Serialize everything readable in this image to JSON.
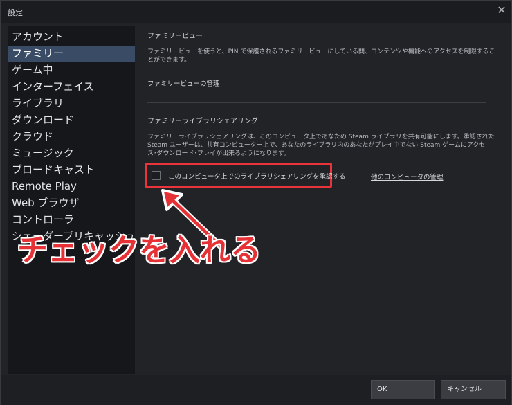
{
  "window": {
    "title": "設定",
    "minimize_glyph": "—",
    "close_glyph": "✕"
  },
  "sidebar": {
    "items": [
      {
        "label": "アカウント"
      },
      {
        "label": "ファミリー"
      },
      {
        "label": "ゲーム中"
      },
      {
        "label": "インターフェイス"
      },
      {
        "label": "ライブラリ"
      },
      {
        "label": "ダウンロード"
      },
      {
        "label": "クラウド"
      },
      {
        "label": "ミュージック"
      },
      {
        "label": "ブロードキャスト"
      },
      {
        "label": "Remote Play"
      },
      {
        "label": "Web ブラウザ"
      },
      {
        "label": "コントローラ"
      },
      {
        "label": "シェーダープリキャッシュ"
      }
    ],
    "active_index": 1
  },
  "family_view": {
    "title": "ファミリービュー",
    "desc_line1": "ファミリービューを使うと、PIN で保護されるファミリービューにしている間、コンテンツや機能へのアクセスを制限するこ",
    "desc_line2": "とができます。",
    "manage_link": "ファミリービューの管理"
  },
  "library_sharing": {
    "title": "ファミリーライブラリシェアリング",
    "desc_line1": "ファミリーライブラリシェアリングは、このコンピュータ上であなたの Steam ライブラリを共有可能にします。承認された",
    "desc_line2": "Steam ユーザーは、共有コンピューター上で、あなたのライブラリ内のあなたがプレイ中でない Steam ゲームにアクセ",
    "desc_line3": "ス･ダウンロード･プレイが出来るようになります。",
    "checkbox_label": "このコンピュータ上でのライブラリシェアリングを承認する",
    "checkbox_checked": false,
    "other_computers_link": "他のコンピュータの管理"
  },
  "annotation": {
    "text": "チェックを入れる",
    "color": "#e63236"
  },
  "footer": {
    "ok_label": "OK",
    "cancel_label": "キャンセル"
  }
}
